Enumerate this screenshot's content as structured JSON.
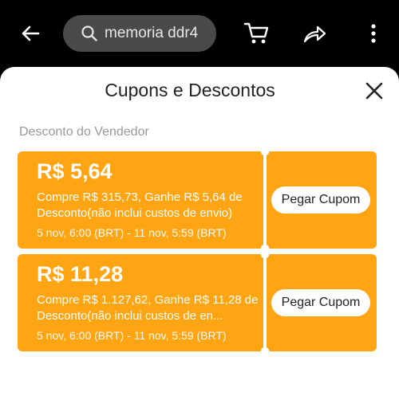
{
  "topbar": {
    "search_text": "memoria ddr4",
    "icons": [
      "back-arrow-icon",
      "search-icon",
      "cart-icon",
      "share-icon",
      "more-vert-icon"
    ]
  },
  "sheet": {
    "title": "Cupons e Descontos",
    "section": "Desconto do Vendedor",
    "coupons": [
      {
        "amount": "R$ 5,64",
        "desc": "Compre R$ 315,73, Ganhe R$ 5,64 de Desconto(não inclui custos de envio)",
        "date": "5 nov, 6:00 (BRT) - 11 nov, 5:59 (BRT)",
        "button": "Pegar Cupom"
      },
      {
        "amount": "R$ 11,28",
        "desc": "Compre R$ 1.127,62, Ganhe R$ 11,28 de Desconto(não inclui custos de en...",
        "date": "5 nov, 6:00 (BRT) - 11 nov, 5:59 (BRT)",
        "button": "Pegar Cupom"
      }
    ]
  },
  "colors": {
    "coupon": "#ffa412",
    "background": "#000000",
    "sheet": "#ffffff"
  }
}
